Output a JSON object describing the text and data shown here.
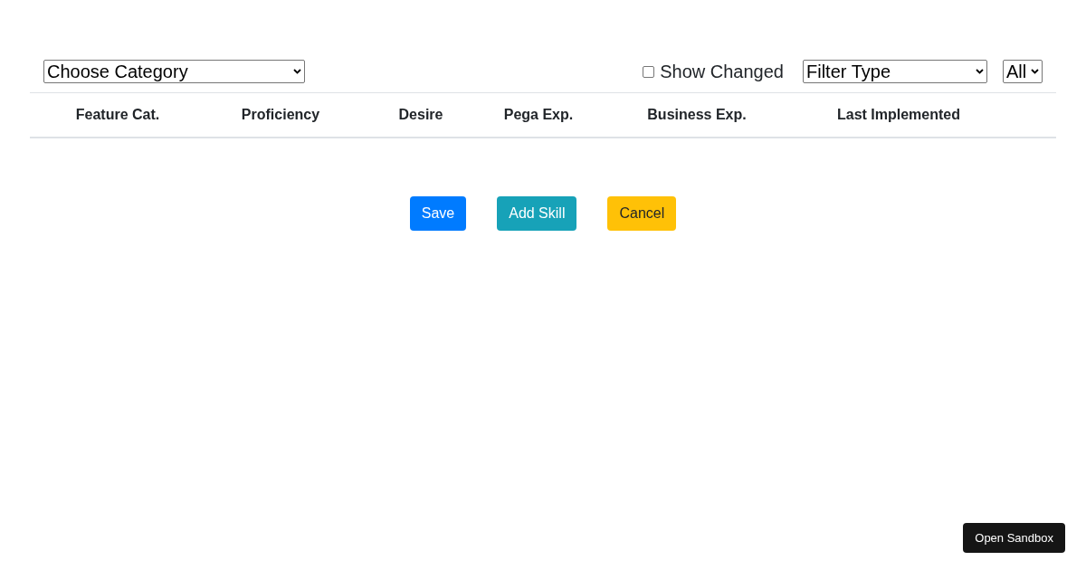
{
  "toolbar": {
    "category_select": {
      "value": "Choose Category"
    },
    "show_changed": {
      "label": "Show Changed",
      "checked": false
    },
    "filter_type_select": {
      "value": "Filter Type"
    },
    "scope_select": {
      "value": "All"
    }
  },
  "table": {
    "columns": [
      "Feature Cat.",
      "Proficiency",
      "Desire",
      "Pega Exp.",
      "Business Exp.",
      "Last Implemented"
    ]
  },
  "buttons": [
    {
      "label": "Save",
      "kind": "primary"
    },
    {
      "label": "Add Skill",
      "kind": "info"
    },
    {
      "label": "Cancel",
      "kind": "warning"
    }
  ],
  "sandbox_button": {
    "label": "Open Sandbox"
  }
}
